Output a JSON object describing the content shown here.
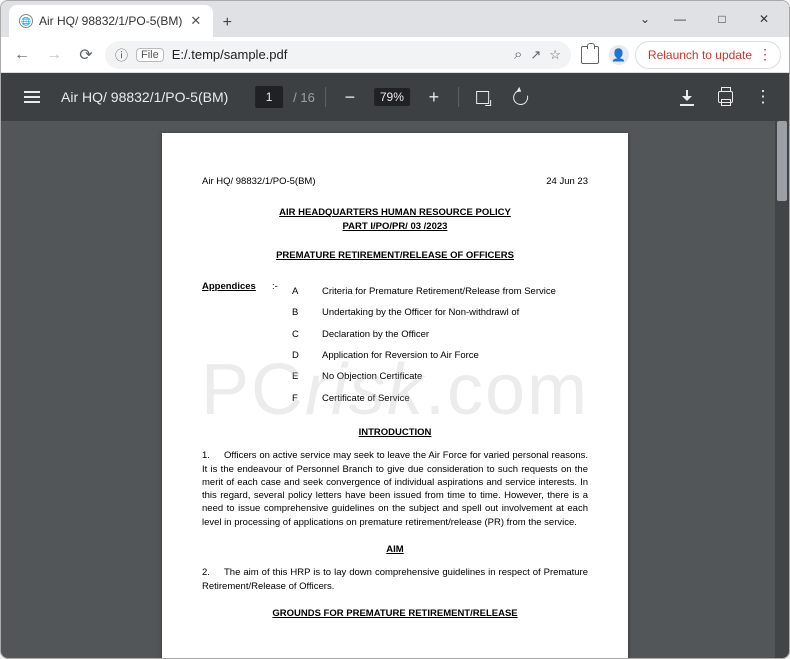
{
  "tab": {
    "title": "Air HQ/ 98832/1/PO-5(BM)"
  },
  "window": {
    "chevron": "⌄",
    "minimize": "—",
    "maximize": "□",
    "close": "✕"
  },
  "nav": {
    "back": "←",
    "forward": "→",
    "reload": "⟳"
  },
  "url": {
    "info_icon": "ⓘ",
    "file_label": "File",
    "path": "E:/.temp/sample.pdf",
    "search": "⌕",
    "share": "↗",
    "bookmark": "☆"
  },
  "profile": {
    "avatar": "👤"
  },
  "relaunch": {
    "label": "Relaunch to update",
    "dots": "⋮"
  },
  "pdf": {
    "doc_title": "Air HQ/ 98832/1/PO-5(BM)",
    "page_current": "1",
    "page_sep": "/",
    "page_total": "16",
    "zoom_minus": "−",
    "zoom_value": "79%",
    "zoom_plus": "+",
    "more": "⋮"
  },
  "doc": {
    "ref": "Air HQ/ 98832/1/PO-5(BM)",
    "date": "24  Jun 23",
    "title_line1": "AIR HEADQUARTERS HUMAN RESOURCE POLICY",
    "title_line2": "PART I/PO/PR/ 03 /2023",
    "subtitle": "PREMATURE RETIREMENT/RELEASE OF OFFICERS",
    "appendices_label": "Appendices",
    "colon": ":-",
    "appendices": [
      {
        "k": "A",
        "v": "Criteria for Premature Retirement/Release from Service"
      },
      {
        "k": "B",
        "v": "Undertaking by the Officer for Non-withdrawl of"
      },
      {
        "k": "C",
        "v": "Declaration by the Officer"
      },
      {
        "k": "D",
        "v": "Application for Reversion to Air Force"
      },
      {
        "k": "E",
        "v": "No Objection Certificate"
      },
      {
        "k": "F",
        "v": "Certificate of Service"
      }
    ],
    "intro_hdr": "INTRODUCTION",
    "para1_num": "1.",
    "para1": "Officers on active service may seek to leave the Air Force for varied personal reasons.  It is the endeavour of Personnel Branch to give due consideration to such requests on the merit of each  case and  seek convergence of individual aspirations and service interests. In this regard, several policy letters have been issued from time to time. However, there is a need to issue comprehensive guidelines on the subject and spell out involvement at each level in processing of applications on premature retirement/release (PR) from the service.",
    "aim_hdr": "AIM",
    "para2_num": "2.",
    "para2": "The aim of this HRP is to lay down comprehensive guidelines in respect of Premature Retirement/Release of Officers.",
    "grounds_hdr": "GROUNDS FOR PREMATURE RETIREMENT/RELEASE"
  },
  "watermark": {
    "pc": "PC",
    "risk": "risk",
    "com": ".com"
  }
}
